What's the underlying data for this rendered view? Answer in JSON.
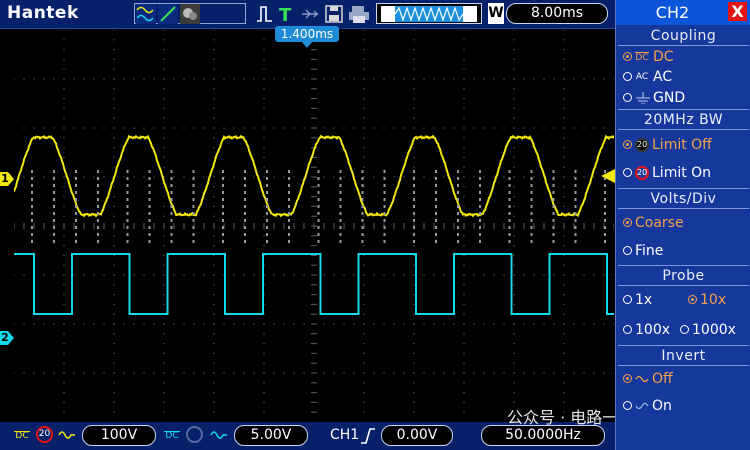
{
  "brand": "Hantek",
  "timebase": "8.00ms",
  "trigger_position": "1.400ms",
  "wave_mode_label": "W",
  "ch1_marker": "1",
  "ch2_marker": "2",
  "bottom": {
    "ch1_coupling": "DC",
    "ch1_bw": "20",
    "ch1_volts": "100V",
    "ch2_coupling": "DC",
    "ch2_volts": "5.00V",
    "trigger_source": "CH1",
    "trigger_level": "0.00V",
    "frequency": "50.0000Hz"
  },
  "panel": {
    "title": "CH2",
    "close": "X",
    "sections": {
      "coupling": "Coupling",
      "bw": "20MHz BW",
      "volts": "Volts/Div",
      "probe": "Probe",
      "invert": "Invert"
    },
    "coupling_options": [
      "DC",
      "AC",
      "GND"
    ],
    "coupling_selected": "DC",
    "coupling_icon_dc": "DC",
    "coupling_icon_ac": "AC",
    "bw_options": [
      "Limit Off",
      "Limit On"
    ],
    "bw_selected": "Limit Off",
    "bw_icon": "20",
    "volts_options": [
      "Coarse",
      "Fine"
    ],
    "volts_selected": "Coarse",
    "probe_options": [
      "1x",
      "10x",
      "100x",
      "1000x"
    ],
    "probe_selected": "10x",
    "invert_options": [
      "Off",
      "On"
    ],
    "invert_selected": "Off"
  },
  "watermark": "公众号 · 电路一点通",
  "colors": {
    "ch1": "#f0e80f",
    "ch2": "#10d8e6",
    "grid": "#5a5a5a",
    "selected": "#f4a24a",
    "panel_bg": "#16379c"
  }
}
